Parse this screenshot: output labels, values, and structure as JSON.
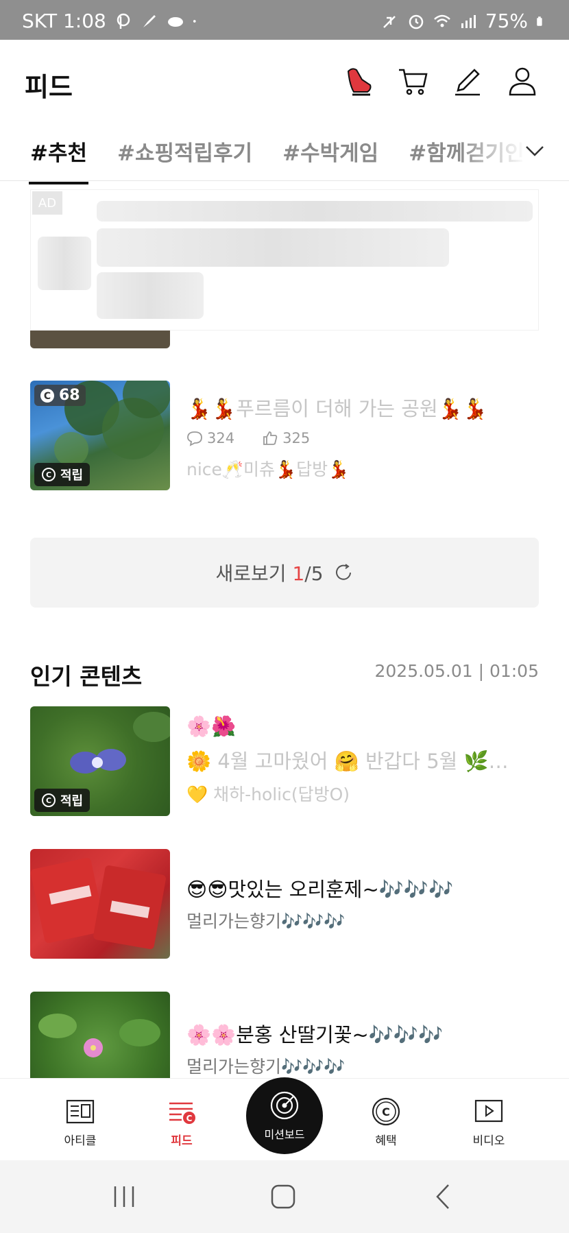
{
  "status_bar": {
    "carrier_time": "SKT 1:08",
    "battery": "75%",
    "icons": [
      "p-icon",
      "brush-icon",
      "cloud-icon",
      "dot-icon",
      "mute-icon",
      "alarm-icon",
      "wifi-icon",
      "signal-icon",
      "battery-icon"
    ]
  },
  "header": {
    "title": "피드",
    "icons": [
      "shoe-icon",
      "cart-icon",
      "pencil-icon",
      "profile-icon"
    ]
  },
  "tabs": [
    {
      "label": "#추천",
      "active": true
    },
    {
      "label": "#쇼핑적립후기",
      "active": false
    },
    {
      "label": "#수박게임",
      "active": false
    },
    {
      "label": "#함께걷기인증",
      "active": false
    }
  ],
  "ad": {
    "label": "AD"
  },
  "feed": {
    "item": {
      "coin_count": "68",
      "badge": "적립",
      "title": "💃💃푸르름이 더해 가는 공원💃💃",
      "comments": "324",
      "likes": "325",
      "subtitle": "nice🥂미츄💃답방💃"
    },
    "refresh": {
      "prefix": "새로보기 ",
      "current": "1",
      "total": "/5"
    }
  },
  "popular": {
    "title": "인기 콘텐츠",
    "timestamp": "2025.05.01 | 01:05",
    "items": [
      {
        "badge": "적립",
        "title_line1": "🌸🌺",
        "title_line2": "🌼 4월 고마웠어 🤗 반갑다 5월 🌿…",
        "author": "💛 채하-holic(답방O)"
      },
      {
        "title": "😎😎맛있는  오리훈제~🎶🎶🎶",
        "author": "멀리가는향기🎶🎶🎶"
      },
      {
        "title": "🌸🌸분홍 산딸기꽃~🎶🎶🎶",
        "author": "멀리가는향기🎶🎶🎶"
      }
    ]
  },
  "bottom_nav": {
    "items": [
      {
        "label": "아티클"
      },
      {
        "label": "피드"
      },
      {
        "label": "미션보드"
      },
      {
        "label": "혜택"
      },
      {
        "label": "비디오"
      }
    ]
  },
  "colors": {
    "accent": "#e0383e",
    "status_bar": "#8f8f8f"
  }
}
